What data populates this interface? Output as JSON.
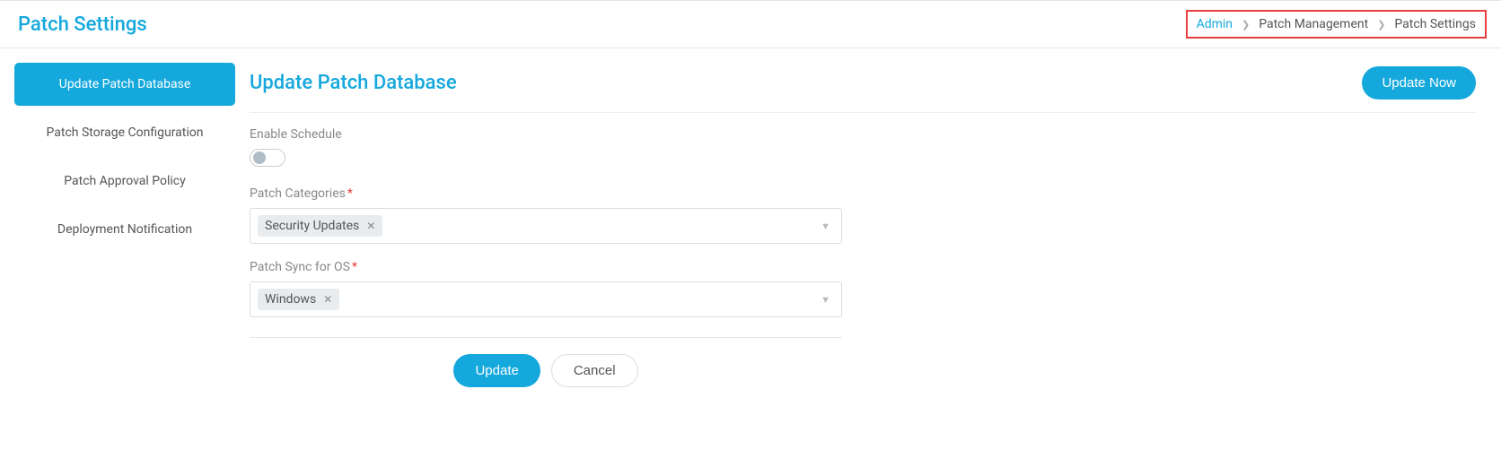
{
  "header": {
    "title": "Patch Settings"
  },
  "breadcrumb": {
    "items": [
      {
        "label": "Admin",
        "link": true
      },
      {
        "label": "Patch Management",
        "link": false
      },
      {
        "label": "Patch Settings",
        "link": false
      }
    ]
  },
  "sidebar": {
    "items": [
      {
        "label": "Update Patch Database",
        "active": true
      },
      {
        "label": "Patch Storage Configuration",
        "active": false
      },
      {
        "label": "Patch Approval Policy",
        "active": false
      },
      {
        "label": "Deployment Notification",
        "active": false
      }
    ]
  },
  "content": {
    "title": "Update Patch Database",
    "update_now_label": "Update Now",
    "form": {
      "enable_schedule": {
        "label": "Enable Schedule",
        "value": false
      },
      "patch_categories": {
        "label": "Patch Categories",
        "required": true,
        "selected": [
          "Security Updates"
        ]
      },
      "patch_sync_os": {
        "label": "Patch Sync for OS",
        "required": true,
        "selected": [
          "Windows"
        ]
      }
    },
    "actions": {
      "update_label": "Update",
      "cancel_label": "Cancel"
    }
  }
}
